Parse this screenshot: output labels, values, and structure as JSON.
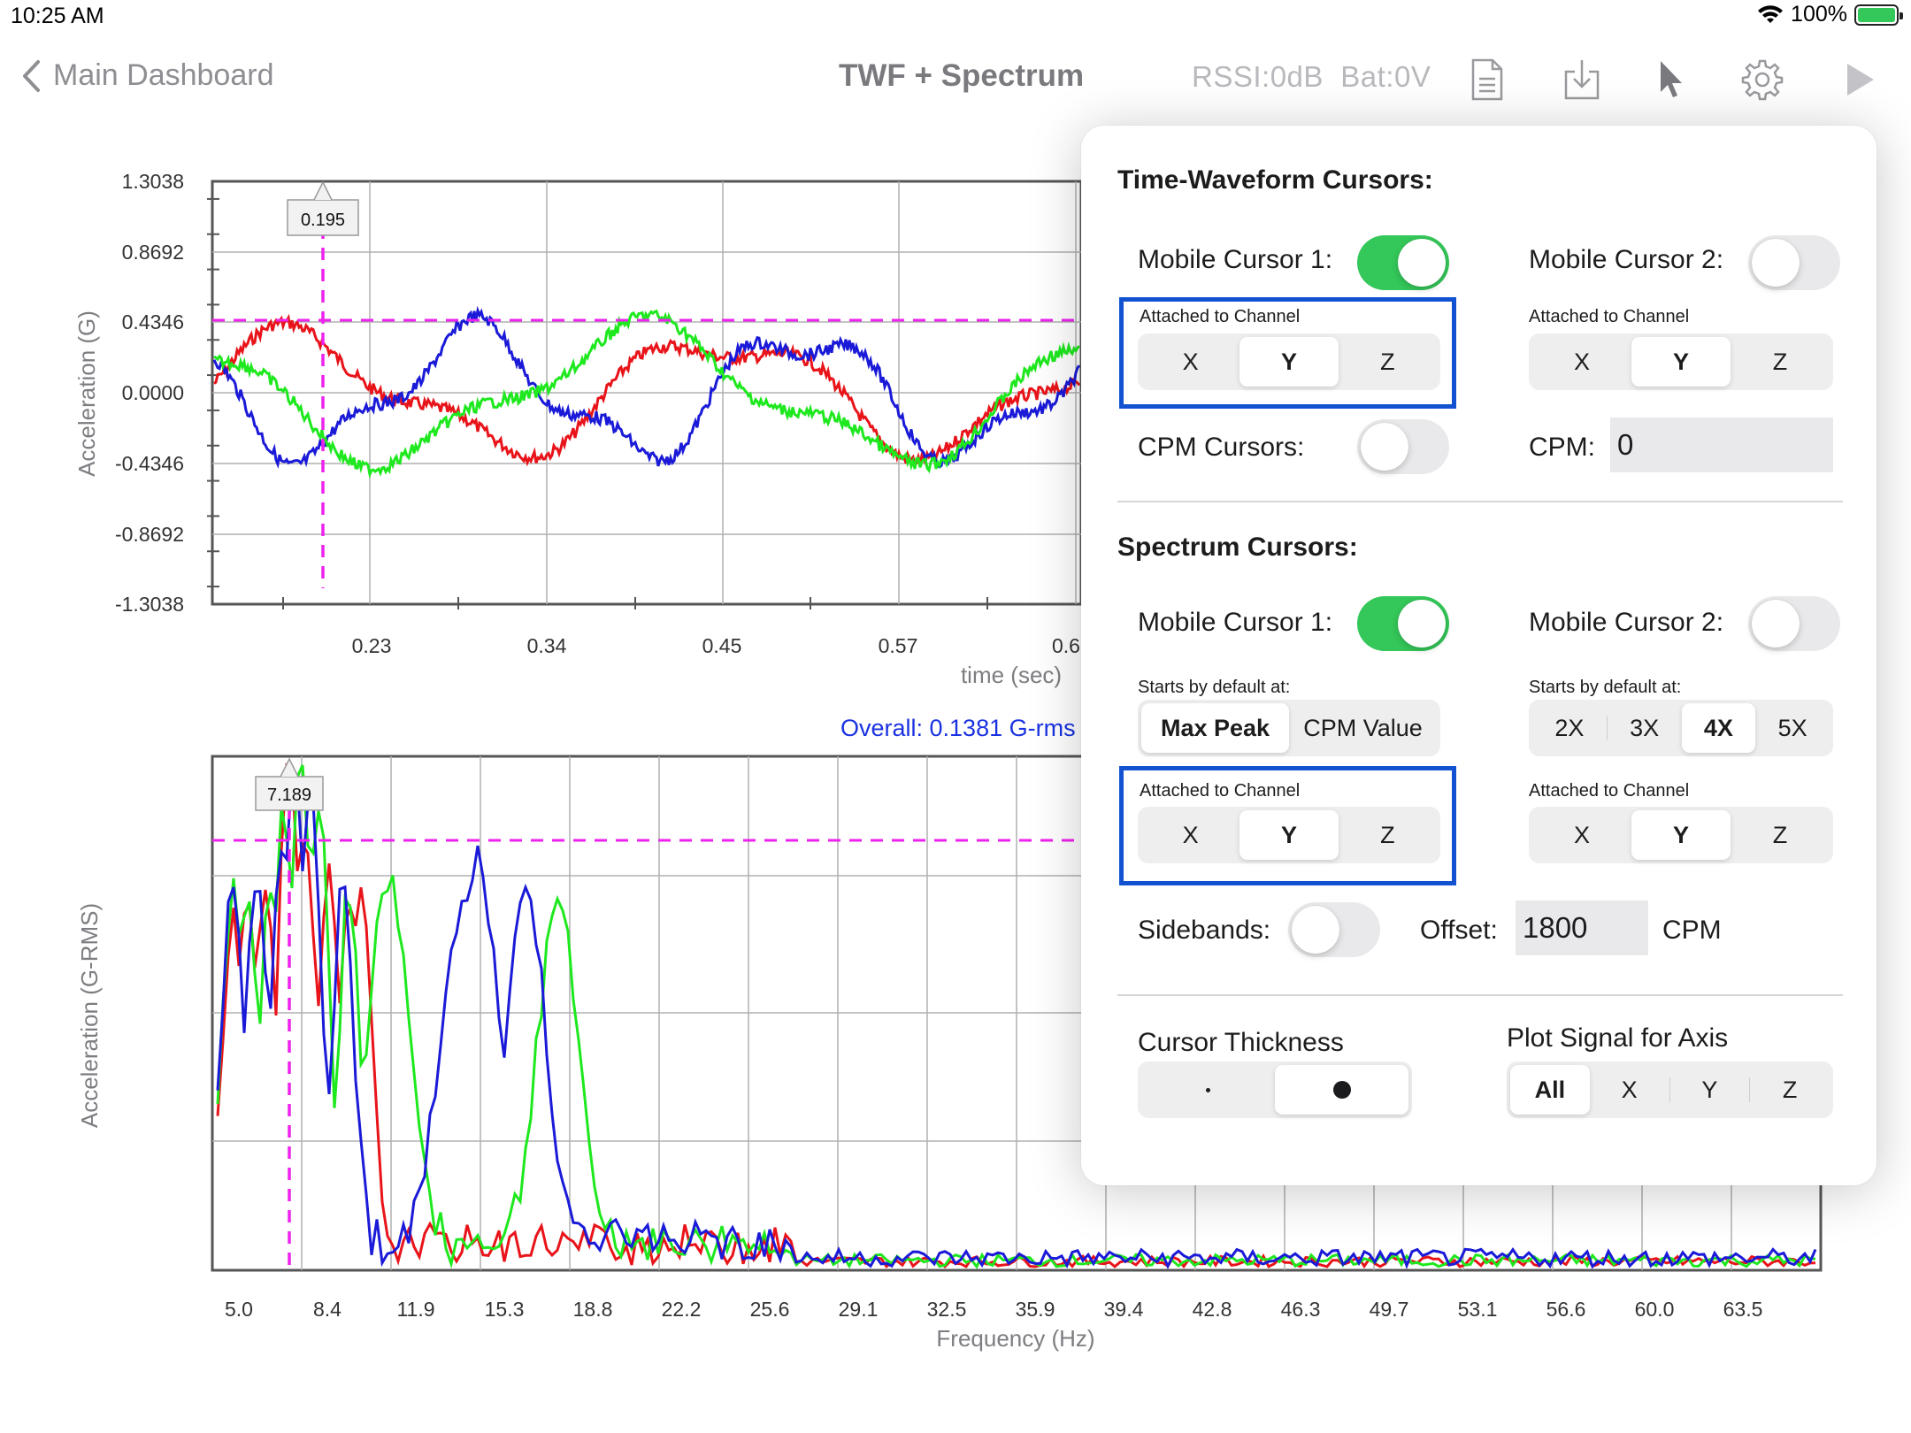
{
  "status_bar": {
    "time": "10:25 AM",
    "battery": "100%"
  },
  "nav": {
    "back_label": "Main Dashboard",
    "title": "TWF + Spectrum",
    "rssi": "RSSI:0dB",
    "battery": "Bat:0V",
    "icons": [
      "document-icon",
      "download-icon",
      "cursor-pointer-icon",
      "gear-icon",
      "play-icon"
    ]
  },
  "waveform": {
    "y_label": "Acceleration (G)",
    "x_label": "time (sec)",
    "y_ticks": [
      "1.3038",
      "0.8692",
      "0.4346",
      "0.0000",
      "-0.4346",
      "-0.8692",
      "-1.3038"
    ],
    "x_ticks": [
      "0.23",
      "0.34",
      "0.45",
      "0.57",
      "0.6"
    ],
    "cursor_value": "0.195"
  },
  "spectrum": {
    "overall": "Overall: 0.1381 G-rms",
    "y_label": "Acceleration (G-RMS)",
    "x_label": "Frequency (Hz)",
    "x_ticks": [
      "5.0",
      "8.4",
      "11.9",
      "15.3",
      "18.8",
      "22.2",
      "25.6",
      "29.1",
      "32.5",
      "35.9",
      "39.4",
      "42.8",
      "46.3",
      "49.7",
      "53.1",
      "56.6",
      "60.0",
      "63.5"
    ],
    "cursor_value": "7.189"
  },
  "colors": {
    "x_channel": "#e8141a",
    "y_channel": "#1a1ad8",
    "z_channel": "#1ee81e",
    "cursor": "#ee22ee",
    "accent_blue": "#1252d0",
    "toggle_on": "#34c759"
  },
  "popover": {
    "twf": {
      "title": "Time-Waveform Cursors:",
      "cursor1_label": "Mobile Cursor 1:",
      "cursor2_label": "Mobile Cursor 2:",
      "cursor1_on": true,
      "cursor2_on": false,
      "attached_label": "Attached to Channel",
      "channels": [
        "X",
        "Y",
        "Z"
      ],
      "cursor1_channel": "Y",
      "cursor2_channel": "Y",
      "cpm_cursors_label": "CPM Cursors:",
      "cpm_cursors_on": false,
      "cpm_label": "CPM:",
      "cpm_value": "0"
    },
    "spectrum": {
      "title": "Spectrum Cursors:",
      "cursor1_label": "Mobile Cursor 1:",
      "cursor2_label": "Mobile Cursor 2:",
      "cursor1_on": true,
      "cursor2_on": false,
      "starts_label": "Starts by default at:",
      "starts_options1": [
        "Max Peak",
        "CPM Value"
      ],
      "starts_selected1": "Max Peak",
      "starts_options2": [
        "2X",
        "3X",
        "4X",
        "5X"
      ],
      "starts_selected2": "4X",
      "attached_label": "Attached to Channel",
      "channels": [
        "X",
        "Y",
        "Z"
      ],
      "cursor1_channel": "Y",
      "cursor2_channel": "Y",
      "sidebands_label": "Sidebands:",
      "sidebands_on": false,
      "offset_label": "Offset:",
      "offset_value": "1800",
      "offset_unit": "CPM"
    },
    "thickness": {
      "label": "Cursor Thickness",
      "options": [
        "thin-dot",
        "thick-dot"
      ],
      "selected": "thick-dot"
    },
    "plot_axis": {
      "label": "Plot Signal for Axis",
      "options": [
        "All",
        "X",
        "Y",
        "Z"
      ],
      "selected": "All"
    }
  }
}
